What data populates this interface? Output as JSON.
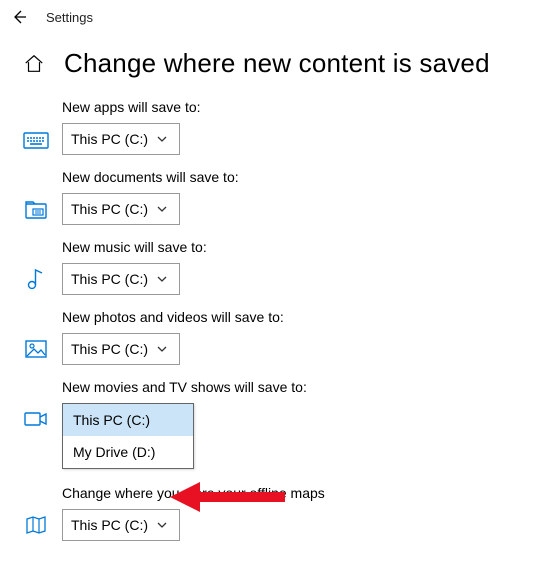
{
  "titlebar": {
    "title": "Settings"
  },
  "page": {
    "heading": "Change where new content is saved"
  },
  "sections": {
    "apps": {
      "label": "New apps will save to:",
      "value": "This PC (C:)"
    },
    "documents": {
      "label": "New documents will save to:",
      "value": "This PC (C:)"
    },
    "music": {
      "label": "New music will save to:",
      "value": "This PC (C:)"
    },
    "photos": {
      "label": "New photos and videos will save to:",
      "value": "This PC (C:)"
    },
    "movies": {
      "label": "New movies and TV shows will save to:",
      "options": [
        "This PC (C:)",
        "My Drive (D:)"
      ],
      "selected": "This PC (C:)"
    },
    "maps": {
      "label": "Change where you store your offline maps",
      "value": "This PC (C:)"
    }
  }
}
